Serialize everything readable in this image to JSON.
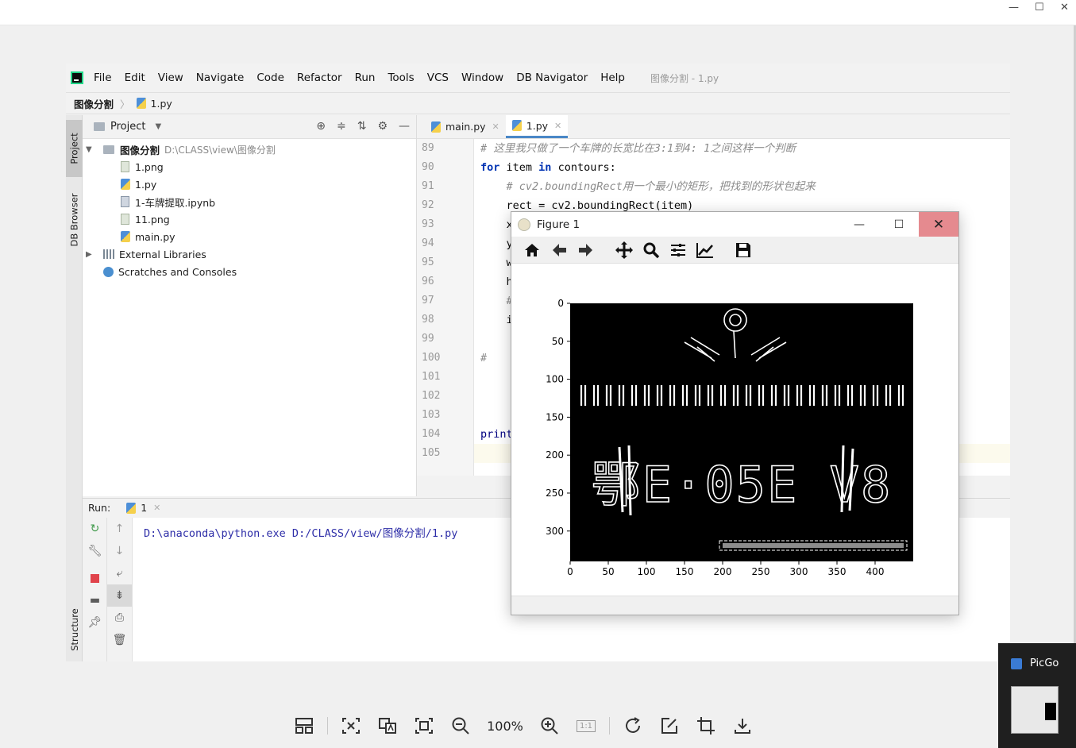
{
  "ide": {
    "menu": [
      "File",
      "Edit",
      "View",
      "Navigate",
      "Code",
      "Refactor",
      "Run",
      "Tools",
      "VCS",
      "Window",
      "DB Navigator",
      "Help"
    ],
    "window_title": "图像分割 - 1.py",
    "breadcrumb": {
      "project": "图像分割",
      "file": "1.py"
    },
    "sidebar_tabs": [
      "Project",
      "DB Browser",
      "Structure"
    ],
    "project_panel": {
      "title": "Project",
      "root_name": "图像分割",
      "root_path": "D:\\CLASS\\view\\图像分割",
      "files": [
        "1.png",
        "1.py",
        "1-车牌提取.ipynb",
        "11.png",
        "main.py"
      ],
      "external": "External Libraries",
      "scratches": "Scratches and Consoles"
    },
    "editor": {
      "tabs": [
        "main.py",
        "1.py"
      ],
      "active_tab": "1.py",
      "line_numbers": [
        "89",
        "90",
        "91",
        "92",
        "93",
        "94",
        "95",
        "96",
        "97",
        "98",
        "99",
        "100",
        "101",
        "102",
        "103",
        "104",
        "105"
      ],
      "lines": [
        "# 这里我只做了一个车牌的长宽比在3:1到4: 1之间这样一个判断",
        "for item in contours:",
        "    # cv2.boundingRect用一个最小的矩形，把找到的形状包起来",
        "    rect = cv2.boundingRect(item)",
        "    x",
        "    y",
        "    w",
        "    h",
        "    #",
        "    i",
        "",
        "#",
        "",
        "",
        "",
        "print",
        ""
      ]
    },
    "run": {
      "label": "Run:",
      "tab": "1",
      "command": "D:\\anaconda\\python.exe D:/CLASS/view/图像分割/1.py"
    }
  },
  "figure": {
    "title": "Figure 1",
    "toolbar_icons": [
      "home-icon",
      "back-icon",
      "forward-icon",
      "pan-icon",
      "zoom-icon",
      "subplots-icon",
      "edit-axes-icon",
      "save-icon"
    ],
    "x_ticks": [
      "0",
      "50",
      "100",
      "150",
      "200",
      "250",
      "300",
      "350",
      "400"
    ],
    "y_ticks": [
      "0",
      "50",
      "100",
      "150",
      "200",
      "250",
      "300"
    ],
    "plate_text": "鄂E·05E V8"
  },
  "viewer": {
    "zoom": "100%",
    "one_to_one": "1:1"
  },
  "notification": {
    "app": "PicGo"
  },
  "colors": {
    "accent": "#4a88c7",
    "keyword": "#0033b3",
    "comment": "#8c8c8c",
    "console": "#2e2ea8",
    "close_hover": "#e58a8f"
  }
}
